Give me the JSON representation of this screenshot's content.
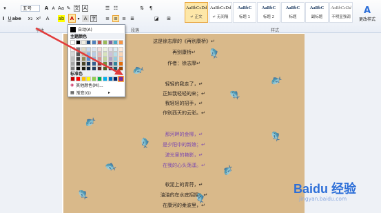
{
  "ribbon": {
    "font_size": "五号",
    "font_group_label": "字体",
    "para_group_label": "段落",
    "styles_group_label": "样式",
    "styles": [
      {
        "sample": "AaBbCcDd",
        "name": "↵ 正文"
      },
      {
        "sample": "AaBbCcDd",
        "name": "↵ 无间隔"
      },
      {
        "sample": "AaBbC",
        "name": "标题 1"
      },
      {
        "sample": "AaBbC",
        "name": "标题 2"
      },
      {
        "sample": "AaBbC",
        "name": "标题"
      },
      {
        "sample": "AaBbC",
        "name": "副标题"
      },
      {
        "sample": "AaBbCcDd",
        "name": "不明显强调"
      }
    ],
    "change_styles_label": "更改样式"
  },
  "color_menu": {
    "auto": "自动(A)",
    "theme_colors": "主题颜色",
    "standard_colors": "标准色",
    "more_colors": "其他颜色(M)...",
    "gradient": "渐变(G)",
    "theme_palette": [
      [
        "#ffffff",
        "#000000",
        "#eeece1",
        "#1f497d",
        "#4f81bd",
        "#c0504d",
        "#9bbb59",
        "#8064a2",
        "#4bacc6",
        "#f79646"
      ],
      [
        "#f2f2f2",
        "#7f7f7f",
        "#ddd9c3",
        "#c6d9f0",
        "#dbe5f1",
        "#f2dcdb",
        "#ebf1dd",
        "#e5e0ec",
        "#dbeef3",
        "#fdeada"
      ],
      [
        "#d8d8d8",
        "#595959",
        "#c4bd97",
        "#8db3e2",
        "#b8cce4",
        "#e5b9b7",
        "#d7e3bc",
        "#ccc1d9",
        "#b7dde8",
        "#fbd5b5"
      ],
      [
        "#bfbfbf",
        "#3f3f3f",
        "#938953",
        "#548dd4",
        "#95b3d7",
        "#d99694",
        "#c3d69b",
        "#b2a2c7",
        "#92cddc",
        "#fac08f"
      ],
      [
        "#a5a5a5",
        "#262626",
        "#494429",
        "#17365d",
        "#366092",
        "#953734",
        "#76923c",
        "#5f497a",
        "#31859b",
        "#e36c09"
      ],
      [
        "#7f7f7f",
        "#0c0c0c",
        "#1d1b10",
        "#0f243e",
        "#244061",
        "#632423",
        "#4f6128",
        "#3f3151",
        "#205867",
        "#974806"
      ]
    ],
    "standard_palette": [
      "#c00000",
      "#ff0000",
      "#ffc000",
      "#ffff00",
      "#92d050",
      "#00b050",
      "#00b0f0",
      "#0070c0",
      "#002060",
      "#7030a0"
    ]
  },
  "document": {
    "lines": [
      {
        "text": "这是徐志摩的《再别康桥》↵",
        "style": "normal"
      },
      {
        "text": "再别康桥↵",
        "style": "normal"
      },
      {
        "text": "作者：徐志摩↵",
        "style": "normal"
      },
      {
        "text": "轻轻的我走了，↵",
        "style": "normal"
      },
      {
        "text": "正如我轻轻的来；↵",
        "style": "normal"
      },
      {
        "text": "我轻轻的招手，↵",
        "style": "normal"
      },
      {
        "text": "作别西天的云彩。↵",
        "style": "normal"
      },
      {
        "text": "那河畔的金柳，↵",
        "style": "purple"
      },
      {
        "text": "是夕阳中的新娘；↵",
        "style": "purple"
      },
      {
        "text": "波光里的艳影，↵",
        "style": "purple"
      },
      {
        "text": "在我的心头荡漾。↵",
        "style": "purple"
      },
      {
        "text": "软泥上的青荇，↵",
        "style": "normal"
      },
      {
        "text": "油油的在水底招摇；↵",
        "style": "normal"
      },
      {
        "text": "在康河的柔波里，↵",
        "style": "normal"
      }
    ]
  },
  "watermark": {
    "logo": "Baidu 经验",
    "sub": "jingyan.baidu.com"
  },
  "colors": {
    "annotation_arrow": "#e23b3b",
    "paper": "#d9b98a",
    "purple_text": "#7b47b0"
  }
}
